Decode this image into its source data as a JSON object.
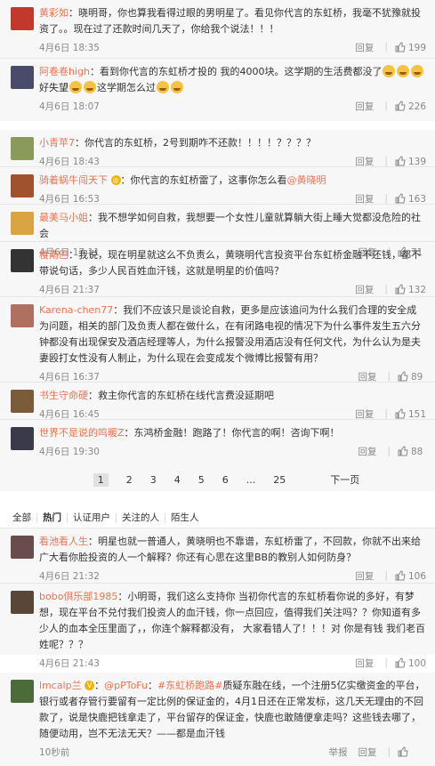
{
  "block1": [
    {
      "user": "黄彩如",
      "text": "：晓明哥，你也算我看得过眼的男明星了。看见你代言的东虹桥，我毫不犹豫就投资了。。现在过了还款时间几天了，你给我个说法！！！",
      "date": "4月6日 18:35",
      "reply": "回复",
      "likes": "199",
      "avatar_color": "#c0392b"
    },
    {
      "user": "阿卷卷high",
      "text": "：看到你代言的东虹桥才投的 我的4000块。这学期的生活费都没了",
      "text2": "好失望",
      "text3": "这学期怎么过",
      "date": "4月6日 18:07",
      "reply": "回复",
      "likes": "226",
      "avatar_color": "#4a4a6a"
    }
  ],
  "block2": [
    {
      "user": "小青苹7",
      "text": "：你代言的东虹桥，2号到期咋不还款！！！！？？？？",
      "date": "4月6日 18:43",
      "reply": "回复",
      "likes": "139",
      "avatar_color": "#8a9a5b"
    },
    {
      "user": "骑着蜗牛闯天下",
      "text": "：你代言的东虹桥雷了，这事你怎么看",
      "mention": "@黄晓明",
      "date": "4月6日 16:53",
      "reply": "回复",
      "likes": "163",
      "avatar_color": "#a0522d"
    },
    {
      "user": "最美马小姐",
      "text": "：我不想学如何自救，我想要一个女性儿童就算躺大街上睡大觉都没危险的社会",
      "date": "4月6日 17:11",
      "reply": "回复",
      "likes": "71",
      "avatar_color": "#d9a441"
    },
    {
      "user": "楼南巴",
      "text": "：我说，现在明星就这么不负责么，黄晓明代言投资平台东虹桥金融不还钱，都不带说句话，多少人民百姓血汗钱，这就是明星的价值吗？",
      "date": "4月6日 21:37",
      "reply": "回复",
      "likes": "132",
      "avatar_color": "#333333"
    },
    {
      "user": "Karena-chen77",
      "text": "：我们不应该只是谈论自救，更多是应该追问为什么我们合理的安全成为问题，相关的部门及负责人都在做什么，在有闭路电视的情况下为什么事件发生五六分钟都没有出现保安及酒店经理等人，为什么报警没用酒店没有任何文代，为什么认为是夫妻殴打女性没有人制止，为什么现在会变成发个微博比报警有用？",
      "date": "4月6日 16:37",
      "reply": "回复",
      "likes": "89",
      "avatar_color": "#b07060"
    },
    {
      "user": "书生守命硬",
      "text": "：救主你代言的东虹桥在线代言费没延期吧",
      "date": "4月6日 16:45",
      "reply": "回复",
      "likes": "151",
      "avatar_color": "#7a5c3a"
    },
    {
      "user": "世界不是说的鸣暖Z",
      "text": "：东鸿桥金融！跑路了！你代言的啊！咨询下啊！",
      "date": "4月6日 19:30",
      "reply": "回复",
      "likes": "88",
      "avatar_color": "#3a3a4a"
    }
  ],
  "pager": {
    "pages": [
      "1",
      "2",
      "3",
      "4",
      "5",
      "6",
      "...",
      "25"
    ],
    "next": "下一页"
  },
  "tabs": [
    "全部",
    "热门",
    "认证用户",
    "关注的人",
    "陌生人"
  ],
  "block3": [
    {
      "user": "看池看人生",
      "text": "：明星也就一普通人，黄晓明也不靠谱，东虹桥雷了，不回款，你就不出来给广大看你脸投资的人一个解释？你还有心思在这里BB的教别人如何防身？",
      "date": "4月6日 21:32",
      "reply": "回复",
      "likes": "106",
      "avatar_color": "#6b4c4c"
    },
    {
      "user": "bobo俱乐部1985",
      "text": "：小明哥，我们这么支持你 当初你代言的东虹桥看你说的多好，有梦想，现在平台不兑付我们投资人的血汗钱，你一点回应，值得我们关注吗？？你知道有多少人的血本全压里面了，，你连个解释都没有， 大家看错人了！！！对 你是有钱 我们老百姓呢？？？",
      "date": "4月6日 21:43",
      "reply": "回复",
      "likes": "100",
      "avatar_color": "#5a4636"
    }
  ],
  "block4": [
    {
      "user": "lmcalp兰",
      "text": "：",
      "mention": "@pPToFu",
      "topic": "#东虹桥跑路#",
      "text2": "质疑东融在线，一个注册5亿实缴资金的平台，银行或者存管行要留有一定比例的保证金的，4月1日还在正常发标，这几天无理由的不回款了，说是快鹿把钱拿走了，平台留存的保证金，快鹿也敢随便拿走吗？这些钱去哪了，随便动用，岂不无法无天？——都是血汗钱",
      "date": "10秒前",
      "reply": "举报",
      "reply2": "回复",
      "avatar_color": "#4d6a3a"
    }
  ]
}
